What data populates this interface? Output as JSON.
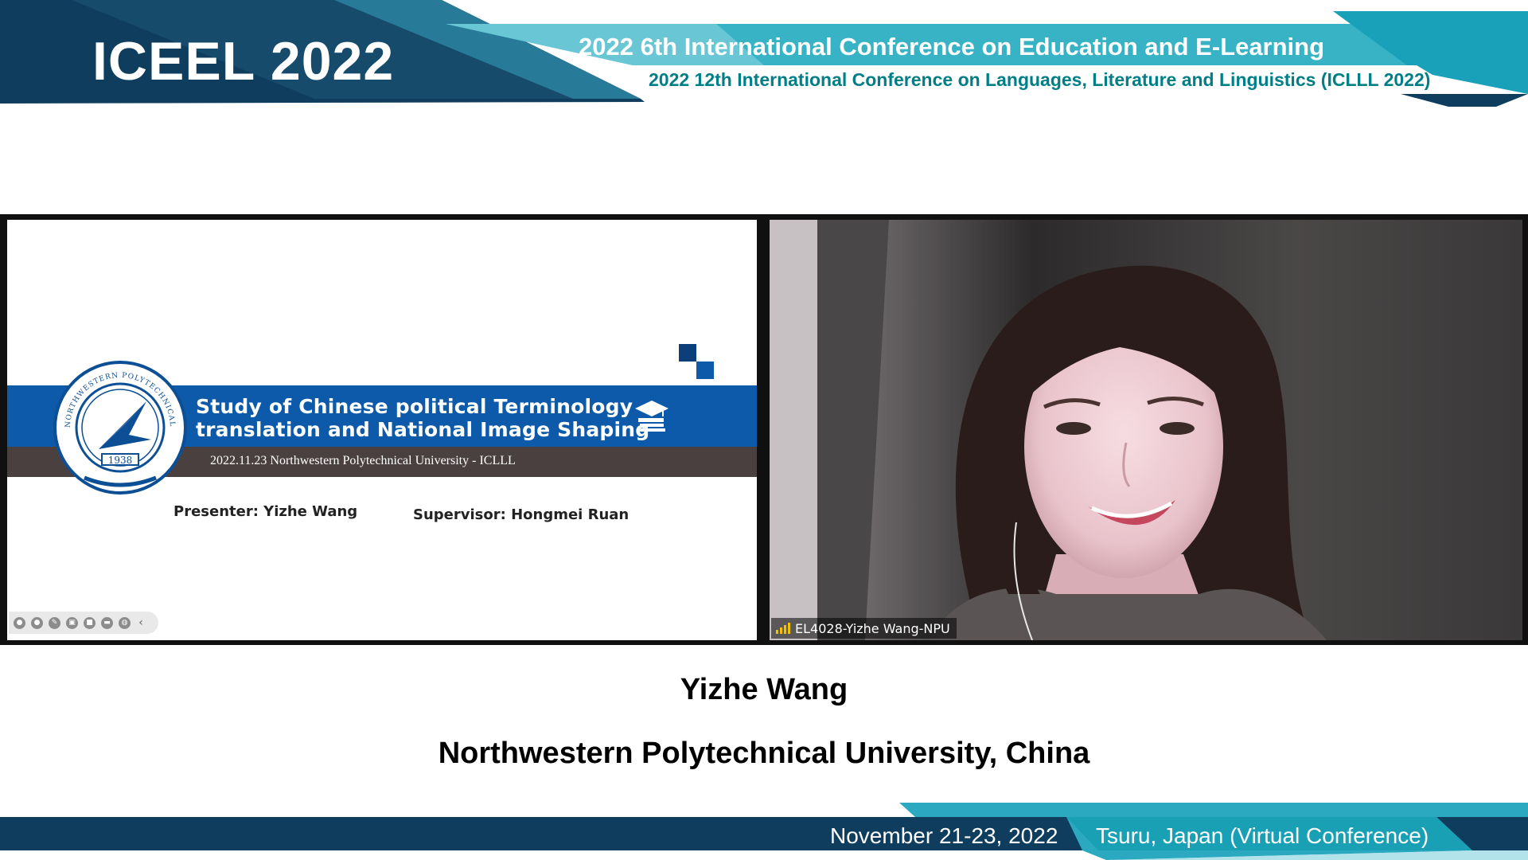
{
  "header": {
    "logo_text": "ICEEL 2022",
    "conference_line1": "2022 6th International Conference on Education and E-Learning",
    "conference_line2": "2022 12th International Conference on Languages, Literature and Linguistics (ICLLL 2022)"
  },
  "shared_slide": {
    "title_line1": "Study of  Chinese political Terminology",
    "title_line2": "translation and National Image Shaping",
    "meta": "2022.11.23 Northwestern Polytechnical University - ICLLL",
    "presenter": "Presenter:  Yizhe Wang",
    "supervisor": "Supervisor: Hongmei Ruan",
    "seal_text": "NORTHWESTERN POLYTECHNICAL UNIVERSITY",
    "seal_year": "1938",
    "toolbar_icons": [
      "pointer-icon",
      "pen-tool-icon",
      "edit-icon",
      "screenshot-icon",
      "camera-icon",
      "chat-icon",
      "globe-icon",
      "collapse-icon"
    ]
  },
  "webcam": {
    "participant_label": "EL4028-Yizhe Wang-NPU",
    "signal_icon": "signal-strength-icon"
  },
  "caption": {
    "name": "Yizhe Wang",
    "affiliation": "Northwestern Polytechnical University, China"
  },
  "footer": {
    "date": "November 21-23, 2022",
    "venue": "Tsuru, Japan (Virtual Conference)"
  },
  "colors": {
    "navy": "#0f3d5e",
    "teal": "#1aa0b5",
    "slide_blue": "#0c5aa9",
    "slide_dark_band": "#4a4040",
    "signal_yellow": "#f2c200"
  }
}
